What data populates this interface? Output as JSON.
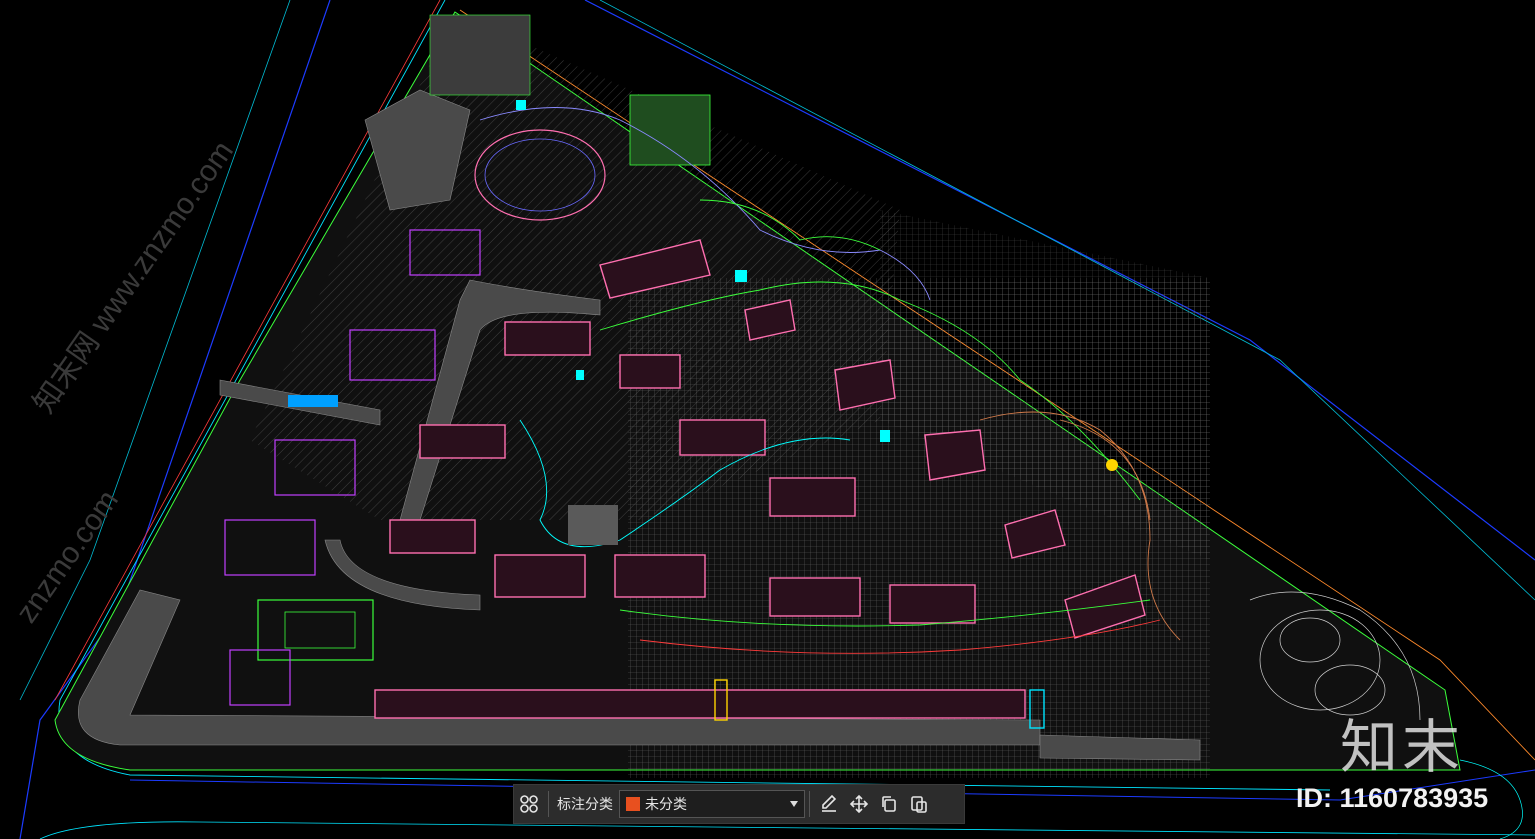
{
  "toolbar": {
    "category_label": "标注分类",
    "category_value": "未分类",
    "category_color": "#e8501f",
    "icons": [
      "grid-icon",
      "edit-icon",
      "move-icon",
      "copy-icon",
      "paste-icon"
    ]
  },
  "watermark": {
    "logo_text": "知末",
    "id_text": "ID: 1160783935",
    "site_text": "知末网 www.znzmo.com",
    "site_text_alt": "znzmo.com"
  },
  "colors": {
    "background": "#000000",
    "building": "#ff6fb0",
    "path": "#3bff3b",
    "water": "#00ffff",
    "grid": "#6c6c6c",
    "boundary": "#1c3bff"
  }
}
